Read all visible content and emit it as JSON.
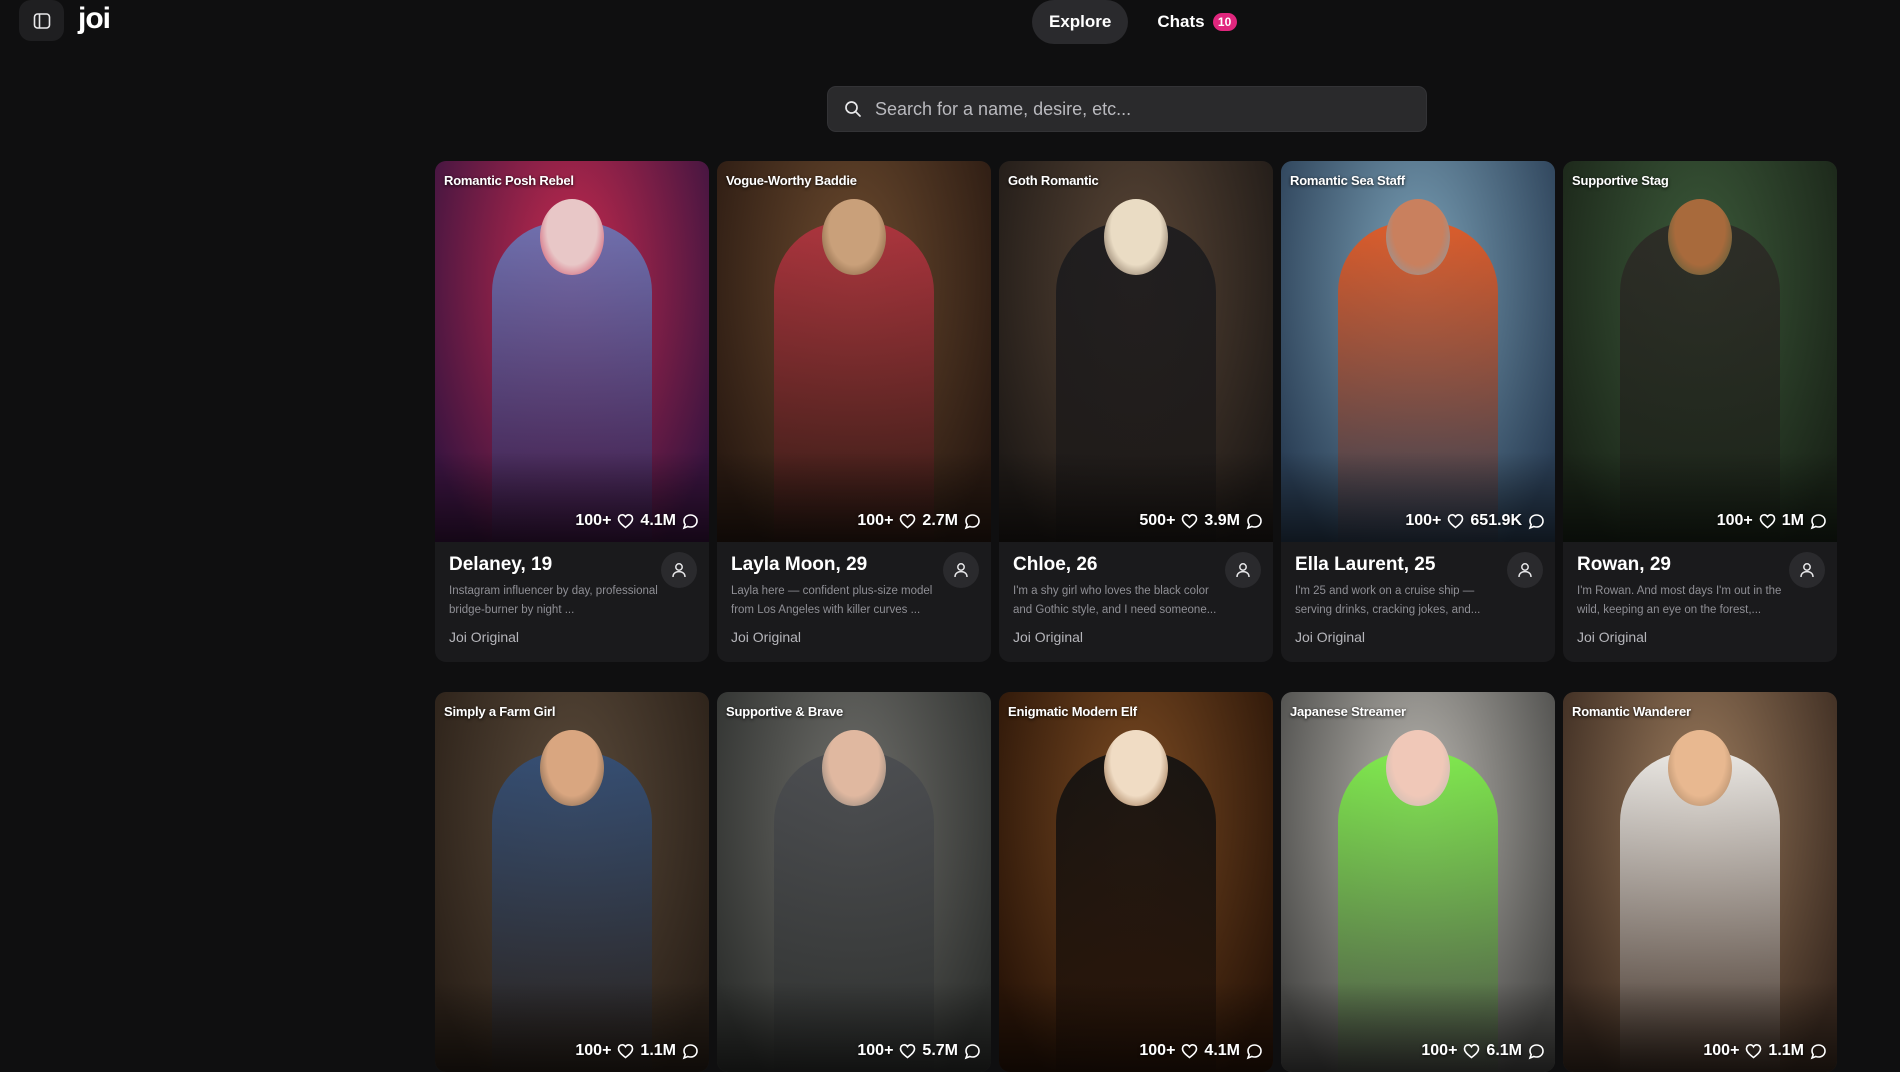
{
  "app": {
    "logo": "joi"
  },
  "nav": {
    "tabs": [
      {
        "label": "Explore",
        "active": true
      },
      {
        "label": "Chats",
        "badge": "10"
      }
    ]
  },
  "search": {
    "placeholder": "Search for a name, desire, etc...",
    "value": ""
  },
  "colors": {
    "accent": "#e0267d",
    "background": "#0f0f10",
    "card": "#1a1a1c"
  },
  "cards": [
    {
      "tag": "Romantic Posh Rebel",
      "likes": "100+",
      "chats": "4.1M",
      "name": "Delaney, 19",
      "desc": "Instagram influencer by day, professional bridge-burner by night ...",
      "origin": "Joi Original",
      "palette": [
        "#c72a4d",
        "#3a1440",
        "#e8c7c7",
        "#6a78b8"
      ]
    },
    {
      "tag": "Vogue-Worthy Baddie",
      "likes": "100+",
      "chats": "2.7M",
      "name": "Layla Moon, 29",
      "desc": "Layla here — confident plus-size model from Los Angeles with killer curves ...",
      "origin": "Joi Original",
      "palette": [
        "#6b4a2e",
        "#2a1a12",
        "#c9a07a",
        "#b43440"
      ]
    },
    {
      "tag": "Goth Romantic",
      "likes": "500+",
      "chats": "3.9M",
      "name": "Chloe, 26",
      "desc": "I'm a shy girl who loves the black color and Gothic style, and I need someone...",
      "origin": "Joi Original",
      "palette": [
        "#5a4636",
        "#1f1a17",
        "#eadcc4",
        "#1b1b1e"
      ]
    },
    {
      "tag": "Romantic Sea Staff",
      "likes": "100+",
      "chats": "651.9K",
      "name": "Ella Laurent, 25",
      "desc": "I'm 25 and work on a cruise ship — serving drinks, cracking jokes, and...",
      "origin": "Joi Original",
      "palette": [
        "#7aa0b6",
        "#2a3e55",
        "#c9805e",
        "#e8581f"
      ]
    },
    {
      "tag": "Supportive Stag",
      "likes": "100+",
      "chats": "1M",
      "name": "Rowan, 29",
      "desc": "I'm Rowan. And most days I'm out in the wild, keeping an eye on the forest,...",
      "origin": "Joi Original",
      "palette": [
        "#3c5a3a",
        "#1a2418",
        "#a86a3c",
        "#2d2a26"
      ]
    },
    {
      "tag": "Simply a Farm Girl",
      "likes": "100+",
      "chats": "1.1M",
      "name": "",
      "desc": "",
      "origin": "",
      "palette": [
        "#5a4a3a",
        "#2a2018",
        "#d9a680",
        "#33507a"
      ]
    },
    {
      "tag": "Supportive & Brave",
      "likes": "100+",
      "chats": "5.7M",
      "name": "",
      "desc": "",
      "origin": "",
      "palette": [
        "#6e6e6a",
        "#2e302e",
        "#e0b8a0",
        "#4a4c50"
      ]
    },
    {
      "tag": "Enigmatic Modern Elf",
      "likes": "100+",
      "chats": "4.1M",
      "name": "",
      "desc": "",
      "origin": "",
      "palette": [
        "#7a4a22",
        "#2a1508",
        "#f0dcc4",
        "#111111"
      ]
    },
    {
      "tag": "Japanese Streamer",
      "likes": "100+",
      "chats": "6.1M",
      "name": "",
      "desc": "",
      "origin": "",
      "palette": [
        "#b9b6b0",
        "#4a4a48",
        "#f0c8b8",
        "#7cf046"
      ]
    },
    {
      "tag": "Romantic Wanderer",
      "likes": "100+",
      "chats": "1.1M",
      "name": "",
      "desc": "",
      "origin": "",
      "palette": [
        "#9a7a5c",
        "#3a2a20",
        "#e8b890",
        "#f4f4f2"
      ]
    }
  ]
}
